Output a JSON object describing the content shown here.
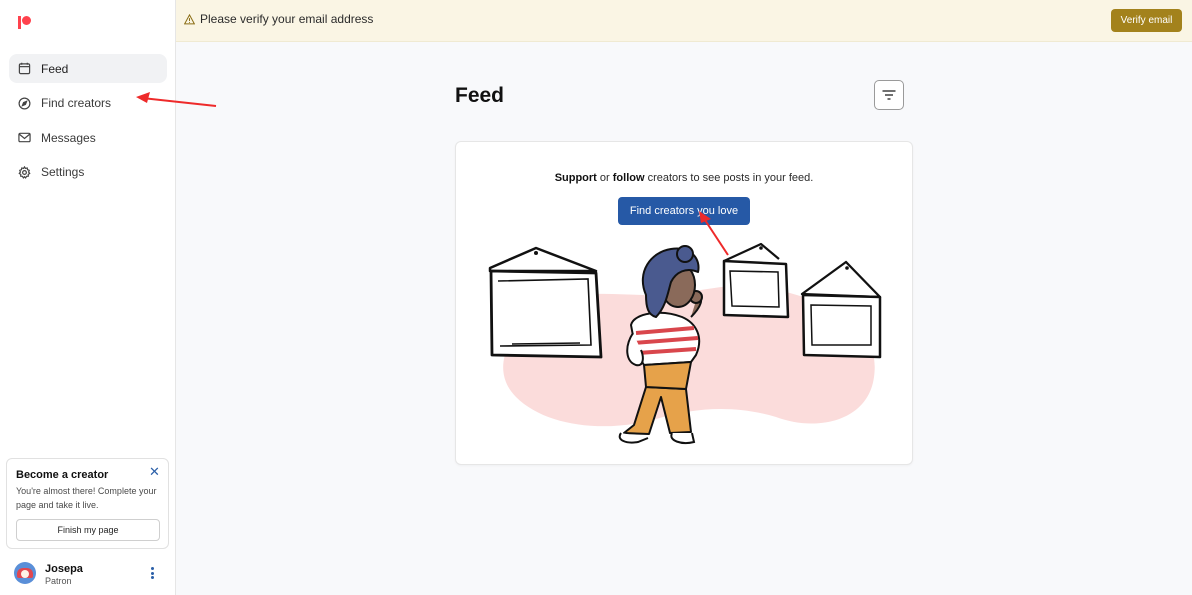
{
  "sidebar": {
    "logo": "patreon-logo",
    "items": [
      {
        "label": "Feed",
        "icon": "feed-icon",
        "active": true
      },
      {
        "label": "Find creators",
        "icon": "compass-icon",
        "active": false
      },
      {
        "label": "Messages",
        "icon": "mail-icon",
        "active": false
      },
      {
        "label": "Settings",
        "icon": "gear-icon",
        "active": false
      }
    ],
    "creator_card": {
      "title": "Become a creator",
      "description": "You're almost there! Complete your page and take it live.",
      "button_label": "Finish my page"
    },
    "user": {
      "name": "Josepa",
      "role": "Patron"
    }
  },
  "banner": {
    "message": "Please verify your email address",
    "button_label": "Verify email",
    "accent": "#a3821c"
  },
  "main": {
    "title": "Feed",
    "card": {
      "support": "Support",
      "or": " or ",
      "follow": "follow",
      "rest": " creators to see posts in your feed.",
      "button_label": "Find creators you love"
    }
  },
  "colors": {
    "brand": "#ff424d",
    "primary_button": "#2659a6"
  }
}
